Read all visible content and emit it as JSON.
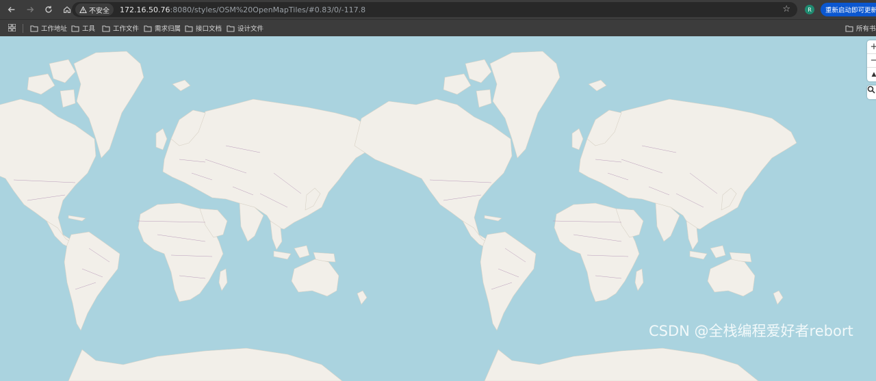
{
  "browser": {
    "security_label": "不安全",
    "url_host": "172.16.50.76",
    "url_path": ":8080/styles/OSM%20OpenMapTiles/#0.83/0/-117.8",
    "profile_initial": "R",
    "update_label": "重新启动即可更新"
  },
  "bookmarks": {
    "items": [
      "工作地址",
      "工具",
      "工作文件",
      "需求归属",
      "接口文档",
      "设计文件"
    ],
    "all_label": "所有书签"
  },
  "map": {
    "zoom_in_label": "+",
    "zoom_out_label": "−",
    "compass_label": "▲",
    "land_color": "#f2efe9",
    "water_color": "#aad3df",
    "border_color": "#b89ab9"
  },
  "watermark": "CSDN @全栈编程爱好者rebort"
}
